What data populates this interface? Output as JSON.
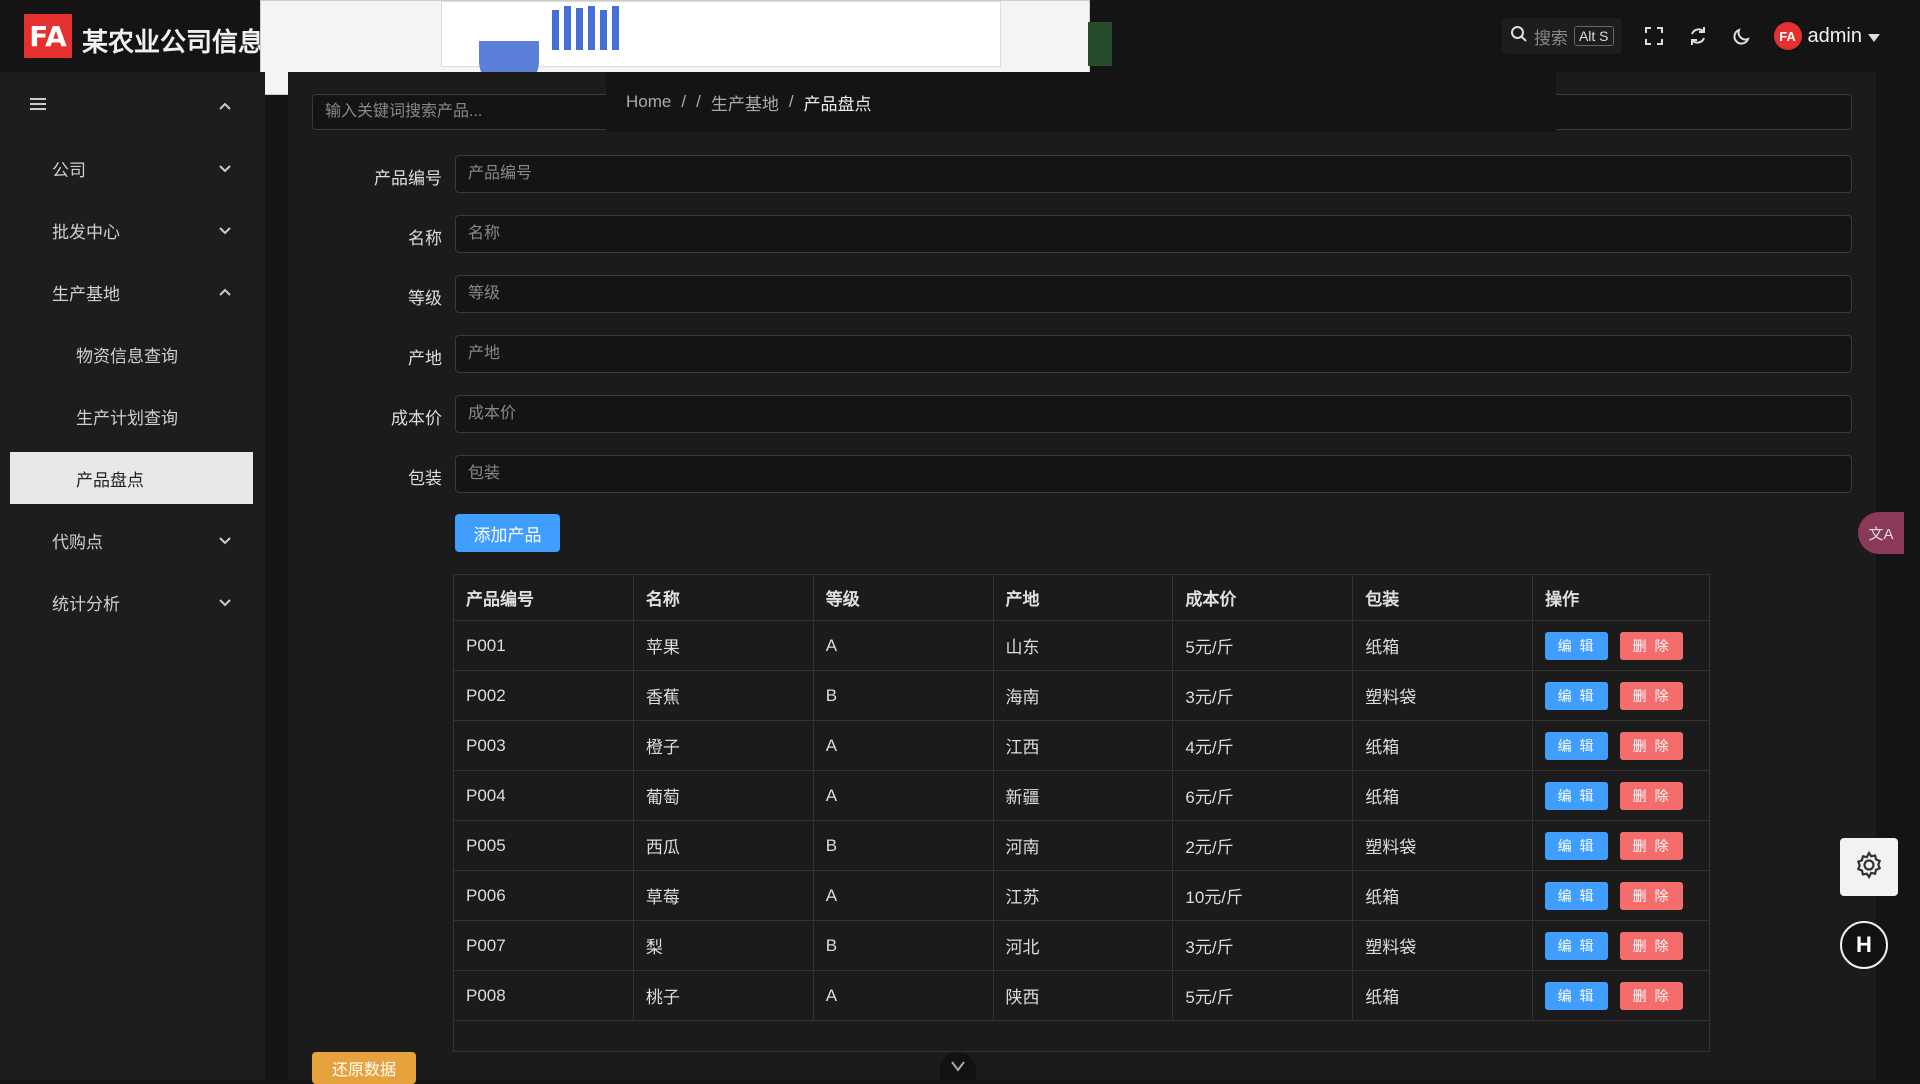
{
  "header": {
    "logo": "FA",
    "brand": "某农业公司信息",
    "search_label": "搜索",
    "search_shortcut": "Alt S",
    "user_avatar": "FA",
    "user_name": "admin"
  },
  "sidebar": {
    "items": [
      {
        "label": "公司"
      },
      {
        "label": "批发中心"
      },
      {
        "label": "生产基地"
      },
      {
        "label": "物资信息查询"
      },
      {
        "label": "生产计划查询"
      },
      {
        "label": "产品盘点"
      },
      {
        "label": "代购点"
      },
      {
        "label": "统计分析"
      }
    ]
  },
  "breadcrumb": {
    "home": "Home",
    "sep": "/",
    "parent": "生产基地",
    "current": "产品盘点"
  },
  "keyword_search": {
    "placeholder": "输入关键词搜索产品..."
  },
  "form": {
    "fields": [
      {
        "label": "产品编号",
        "placeholder": "产品编号"
      },
      {
        "label": "名称",
        "placeholder": "名称"
      },
      {
        "label": "等级",
        "placeholder": "等级"
      },
      {
        "label": "产地",
        "placeholder": "产地"
      },
      {
        "label": "成本价",
        "placeholder": "成本价"
      },
      {
        "label": "包装",
        "placeholder": "包装"
      }
    ],
    "add_button": "添加产品"
  },
  "table": {
    "columns": [
      "产品编号",
      "名称",
      "等级",
      "产地",
      "成本价",
      "包装",
      "操作"
    ],
    "edit_label": "编 辑",
    "delete_label": "删 除",
    "rows": [
      [
        "P001",
        "苹果",
        "A",
        "山东",
        "5元/斤",
        "纸箱"
      ],
      [
        "P002",
        "香蕉",
        "B",
        "海南",
        "3元/斤",
        "塑料袋"
      ],
      [
        "P003",
        "橙子",
        "A",
        "江西",
        "4元/斤",
        "纸箱"
      ],
      [
        "P004",
        "葡萄",
        "A",
        "新疆",
        "6元/斤",
        "纸箱"
      ],
      [
        "P005",
        "西瓜",
        "B",
        "河南",
        "2元/斤",
        "塑料袋"
      ],
      [
        "P006",
        "草莓",
        "A",
        "江苏",
        "10元/斤",
        "纸箱"
      ],
      [
        "P007",
        "梨",
        "B",
        "河北",
        "3元/斤",
        "塑料袋"
      ],
      [
        "P008",
        "桃子",
        "A",
        "陕西",
        "5元/斤",
        "纸箱"
      ]
    ]
  },
  "restore_button": "还原数据",
  "floating": {
    "translate": "文A",
    "h_badge": "H"
  }
}
